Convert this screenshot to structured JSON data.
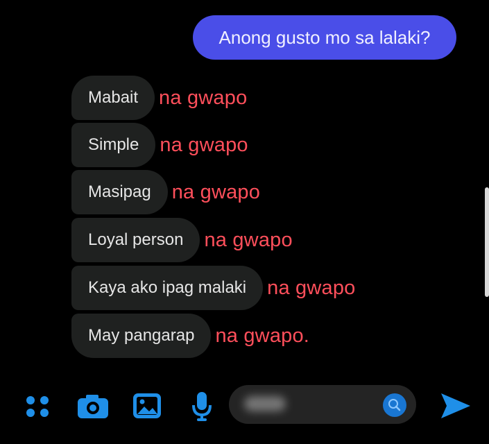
{
  "chat": {
    "sent_message": "Anong gusto mo sa lalaki?",
    "received": [
      {
        "text": "Mabait",
        "overlay": "na gwapo"
      },
      {
        "text": "Simple",
        "overlay": "na gwapo"
      },
      {
        "text": "Masipag",
        "overlay": "na gwapo"
      },
      {
        "text": "Loyal person",
        "overlay": "na gwapo"
      },
      {
        "text": "Kaya ako ipag malaki",
        "overlay": "na gwapo"
      },
      {
        "text": "May pangarap",
        "overlay": "na gwapo."
      }
    ]
  },
  "composer": {
    "icons": [
      "apps-icon",
      "camera-icon",
      "image-icon",
      "microphone-icon",
      "search-icon",
      "send-icon"
    ]
  },
  "colors": {
    "sent_bubble": "#4a4ee8",
    "received_bubble": "#1f2120",
    "overlay_text": "#ff4f5b",
    "accent": "#1f8fe8"
  }
}
